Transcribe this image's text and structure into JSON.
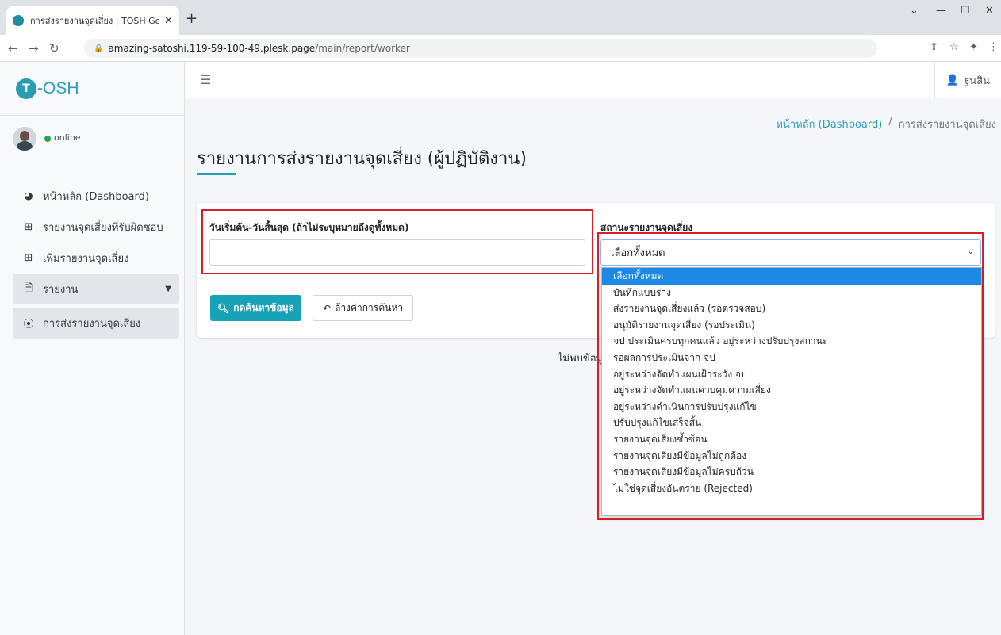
{
  "browser": {
    "tab_title": "การส่งรายงานจุดเสี่ยง | TOSH Good",
    "url_host": "amazing-satoshi.119-59-100-49.plesk.page",
    "url_path": "/main/report/worker"
  },
  "brand": {
    "logo_letter": "T",
    "name": "-OSH"
  },
  "user": {
    "status": "online",
    "name": "ฐนสิน"
  },
  "sidebar": {
    "items": [
      {
        "label": "หน้าหลัก (Dashboard)",
        "icon": "gauge-icon"
      },
      {
        "label": "รายงานจุดเสี่ยงที่รับผิดชอบ",
        "icon": "table-icon"
      },
      {
        "label": "เพิ่มรายงานจุดเสี่ยง",
        "icon": "plus-square-icon"
      },
      {
        "label": "รายงาน",
        "icon": "file-icon"
      },
      {
        "label": "การส่งรายงานจุดเสี่ยง",
        "icon": "circle-dot-icon"
      }
    ]
  },
  "breadcrumb": {
    "home": "หน้าหลัก (Dashboard)",
    "separator": "/",
    "current": "การส่งรายงานจุดเสี่ยง"
  },
  "page": {
    "title": "รายงานการส่งรายงานจุดเสี่ยง (ผู้ปฏิบัติงาน)"
  },
  "filters": {
    "date_label": "วันเริ่มต้น-วันสิ้นสุด (ถ้าไม่ระบุหมายถึงดูทั้งหมด)",
    "date_value": "",
    "status_label": "สถานะรายงานจุดเสี่ยง",
    "status_selected": "เลือกทั้งหมด",
    "status_options": [
      "เลือกทั้งหมด",
      "บันทึกแบบร่าง",
      "ส่งรายงานจุดเสี่ยงแล้ว (รอตรวจสอบ)",
      "อนุมัติรายงานจุดเสี่ยง (รอประเมิน)",
      "จป ประเมินครบทุกคนแล้ว อยู่ระหว่างปรับปรุงสถานะ",
      "รอผลการประเมินจาก จป",
      "อยู่ระหว่างจัดทำแผนเฝ้าระวัง จป",
      "อยู่ระหว่างจัดทำแผนควบคุมความเสี่ยง",
      "อยู่ระหว่างดำเนินการปรับปรุงแก้ไข",
      "ปรับปรุงแก้ไขเสร็จสิ้น",
      "รายงานจุดเสี่ยงซ้ำซ้อน",
      "รายงานจุดเสี่ยงมีข้อมูลไม่ถูกต้อง",
      "รายงานจุดเสี่ยงมีข้อมูลไม่ครบถ้วน",
      "ไม่ใช่จุดเสี่ยงอันตราย (Rejected)"
    ],
    "search_button": "กดค้นหาข้อมูล",
    "reset_button": "ล้างค่าการค้นหา"
  },
  "results": {
    "empty_text": "ไม่พบข้อมูล"
  },
  "colors": {
    "accent": "#2a9db3",
    "button": "#17a2b8",
    "highlight": "#dc1f26",
    "selected_option": "#1e88e5"
  }
}
